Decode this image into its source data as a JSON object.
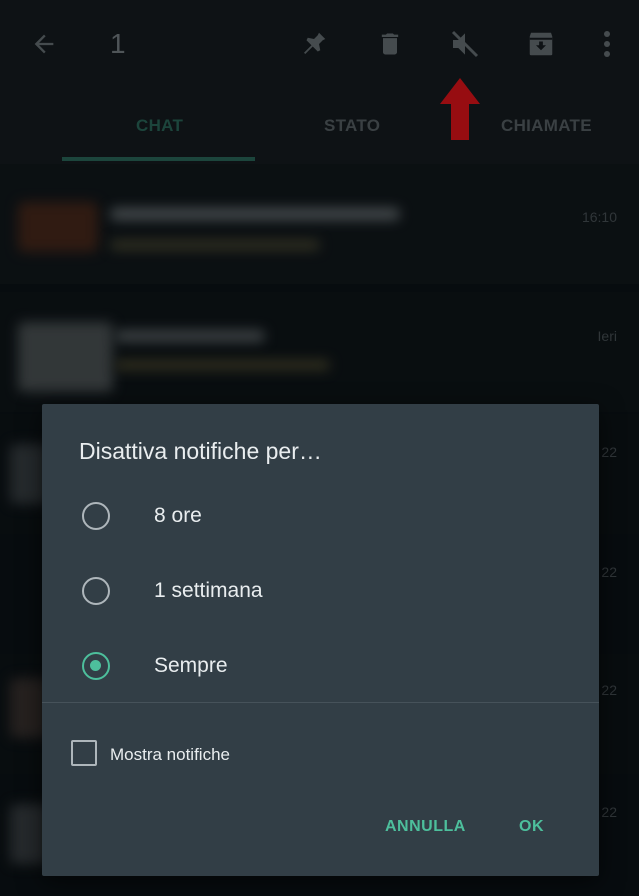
{
  "appbar": {
    "selected_count": "1",
    "icons": [
      "back-arrow-icon",
      "pin-icon",
      "delete-icon",
      "mute-icon",
      "archive-icon",
      "more-vert-icon"
    ]
  },
  "tabs": [
    {
      "label": "CHAT",
      "active": true
    },
    {
      "label": "STATO",
      "active": false
    },
    {
      "label": "CHIAMATE",
      "active": false
    }
  ],
  "chat_list": {
    "times": [
      "16:10",
      "Ieri",
      "22",
      "22",
      "22",
      "22"
    ]
  },
  "dialog": {
    "title": "Disattiva notifiche per…",
    "options": [
      {
        "label": "8 ore",
        "selected": false
      },
      {
        "label": "1 settimana",
        "selected": false
      },
      {
        "label": "Sempre",
        "selected": true
      }
    ],
    "show_notifications_label": "Mostra notifiche",
    "show_notifications_checked": false,
    "cancel_label": "ANNULLA",
    "ok_label": "OK"
  },
  "colors": {
    "accent": "#4dbf9c",
    "dialog_bg": "#323e46",
    "annotation_arrow": "#e8141b"
  }
}
